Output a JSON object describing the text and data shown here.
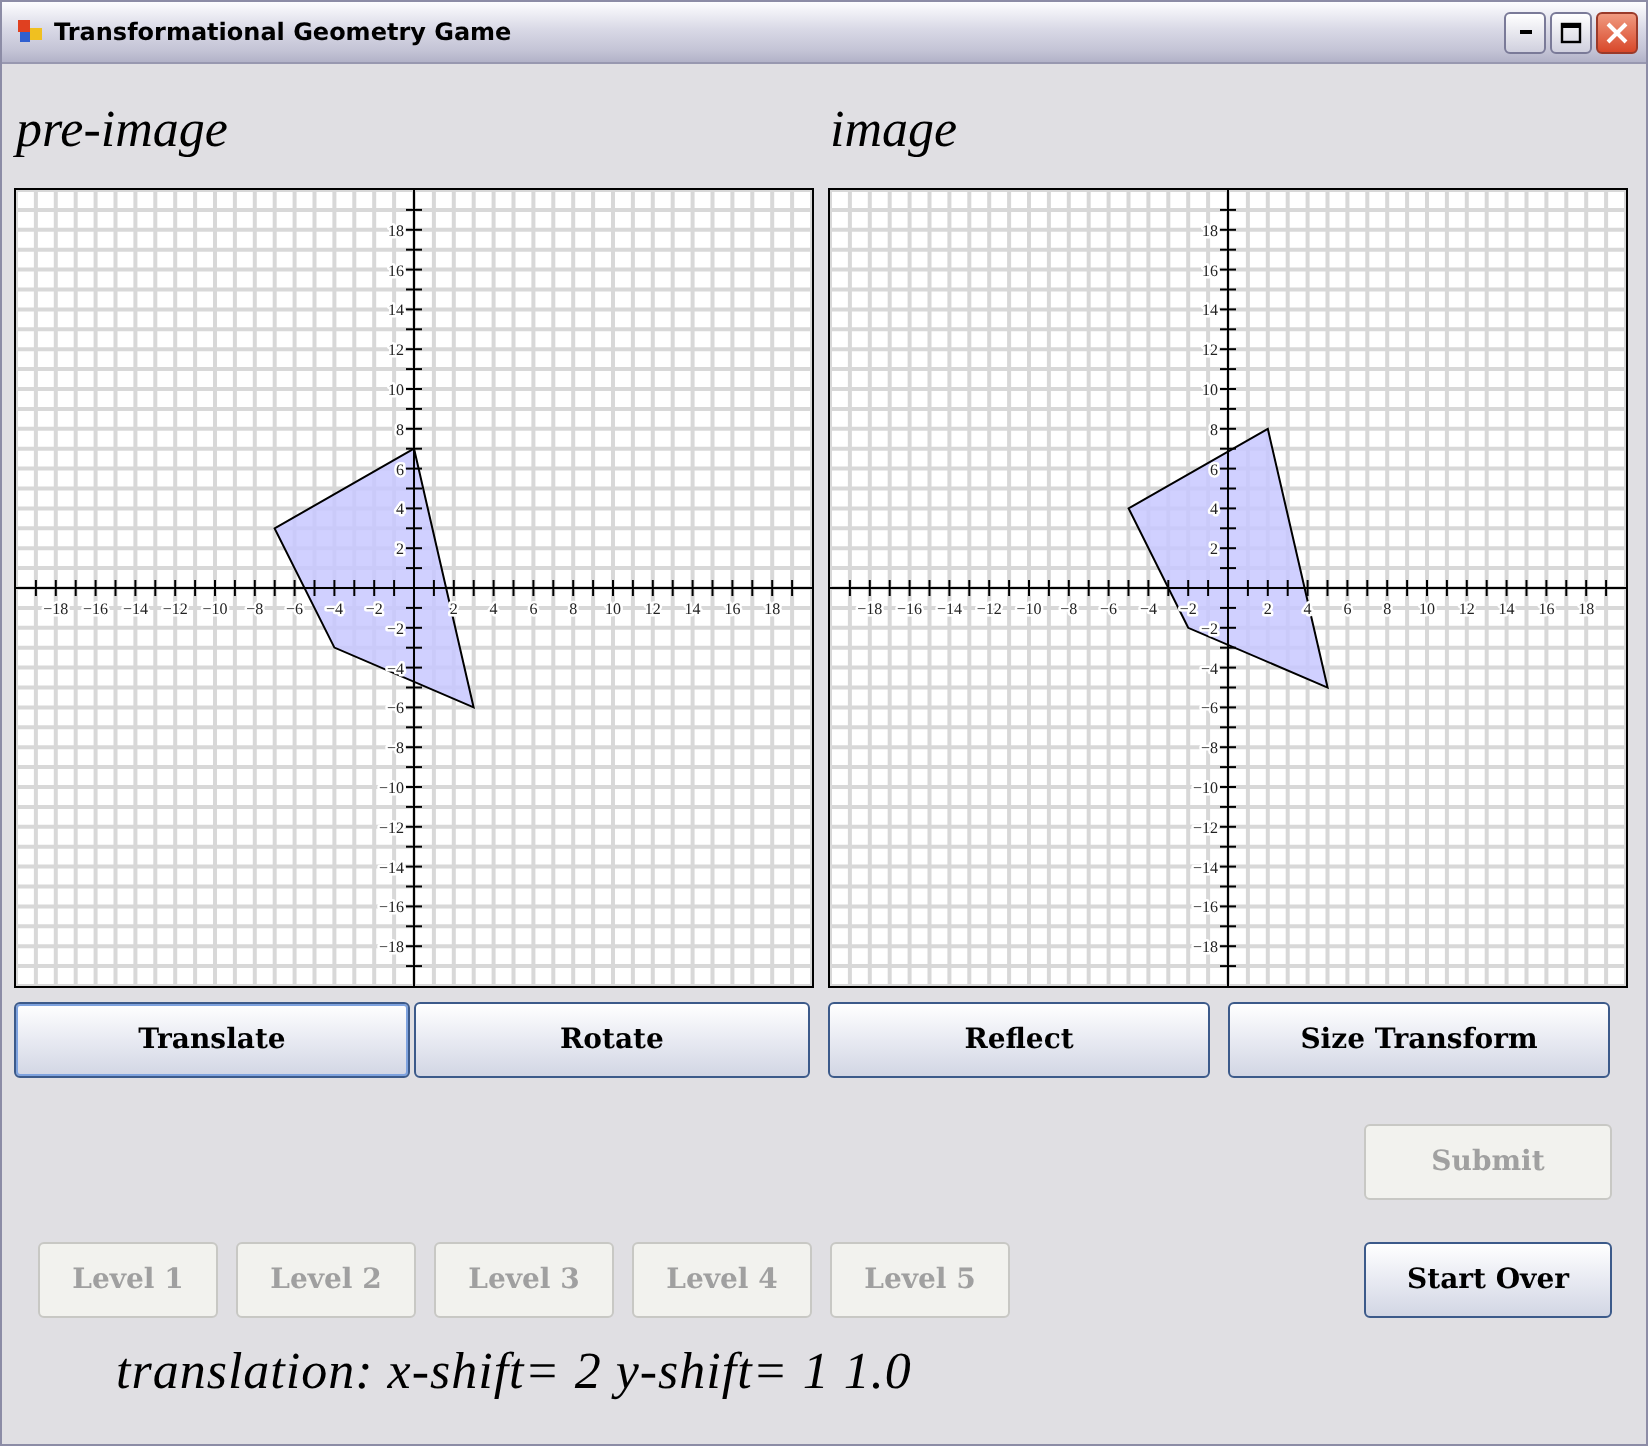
{
  "window": {
    "title": "Transformational Geometry Game"
  },
  "panels": [
    {
      "heading": "pre-image",
      "chart_data": {
        "type": "area",
        "grid": true,
        "x": [
          0,
          -7,
          -4,
          3,
          0
        ],
        "series": [
          {
            "color": "#c8c8ff",
            "values": [
              7,
              3,
              -3,
              -6,
              7
            ]
          }
        ],
        "xlim": [
          -20,
          20
        ],
        "ylim": [
          -20,
          20
        ],
        "xticks": [
          -18,
          -16,
          -14,
          -12,
          -10,
          -8,
          -6,
          -4,
          -2,
          2,
          4,
          6,
          8,
          10,
          12,
          14,
          16,
          18
        ],
        "yticks": [
          -18,
          -16,
          -14,
          -12,
          -10,
          -8,
          -6,
          -4,
          -2,
          2,
          4,
          6,
          8,
          10,
          12,
          14,
          16,
          18
        ]
      }
    },
    {
      "heading": "image",
      "chart_data": {
        "type": "area",
        "grid": true,
        "x": [
          2,
          -5,
          -2,
          5,
          2
        ],
        "series": [
          {
            "color": "#c8c8ff",
            "values": [
              8,
              4,
              -2,
              -5,
              8
            ]
          }
        ],
        "xlim": [
          -20,
          20
        ],
        "ylim": [
          -20,
          20
        ],
        "xticks": [
          -18,
          -16,
          -14,
          -12,
          -10,
          -8,
          -6,
          -4,
          -2,
          2,
          4,
          6,
          8,
          10,
          12,
          14,
          16,
          18
        ],
        "yticks": [
          -18,
          -16,
          -14,
          -12,
          -10,
          -8,
          -6,
          -4,
          -2,
          2,
          4,
          6,
          8,
          10,
          12,
          14,
          16,
          18
        ]
      }
    }
  ],
  "transform_buttons": [
    {
      "label": "Translate",
      "selected": true
    },
    {
      "label": "Rotate",
      "selected": false
    },
    {
      "label": "Reflect",
      "selected": false
    },
    {
      "label": "Size Transform",
      "selected": false
    }
  ],
  "submit_button": {
    "label": "Submit",
    "disabled": true
  },
  "level_buttons": [
    {
      "label": "Level 1",
      "disabled": true
    },
    {
      "label": "Level 2",
      "disabled": true
    },
    {
      "label": "Level 3",
      "disabled": true
    },
    {
      "label": "Level 4",
      "disabled": true
    },
    {
      "label": "Level 5",
      "disabled": true
    }
  ],
  "start_over_button": {
    "label": "Start Over",
    "disabled": false
  },
  "status_text": "translation: x-shift= 2 y-shift= 1 1.0"
}
